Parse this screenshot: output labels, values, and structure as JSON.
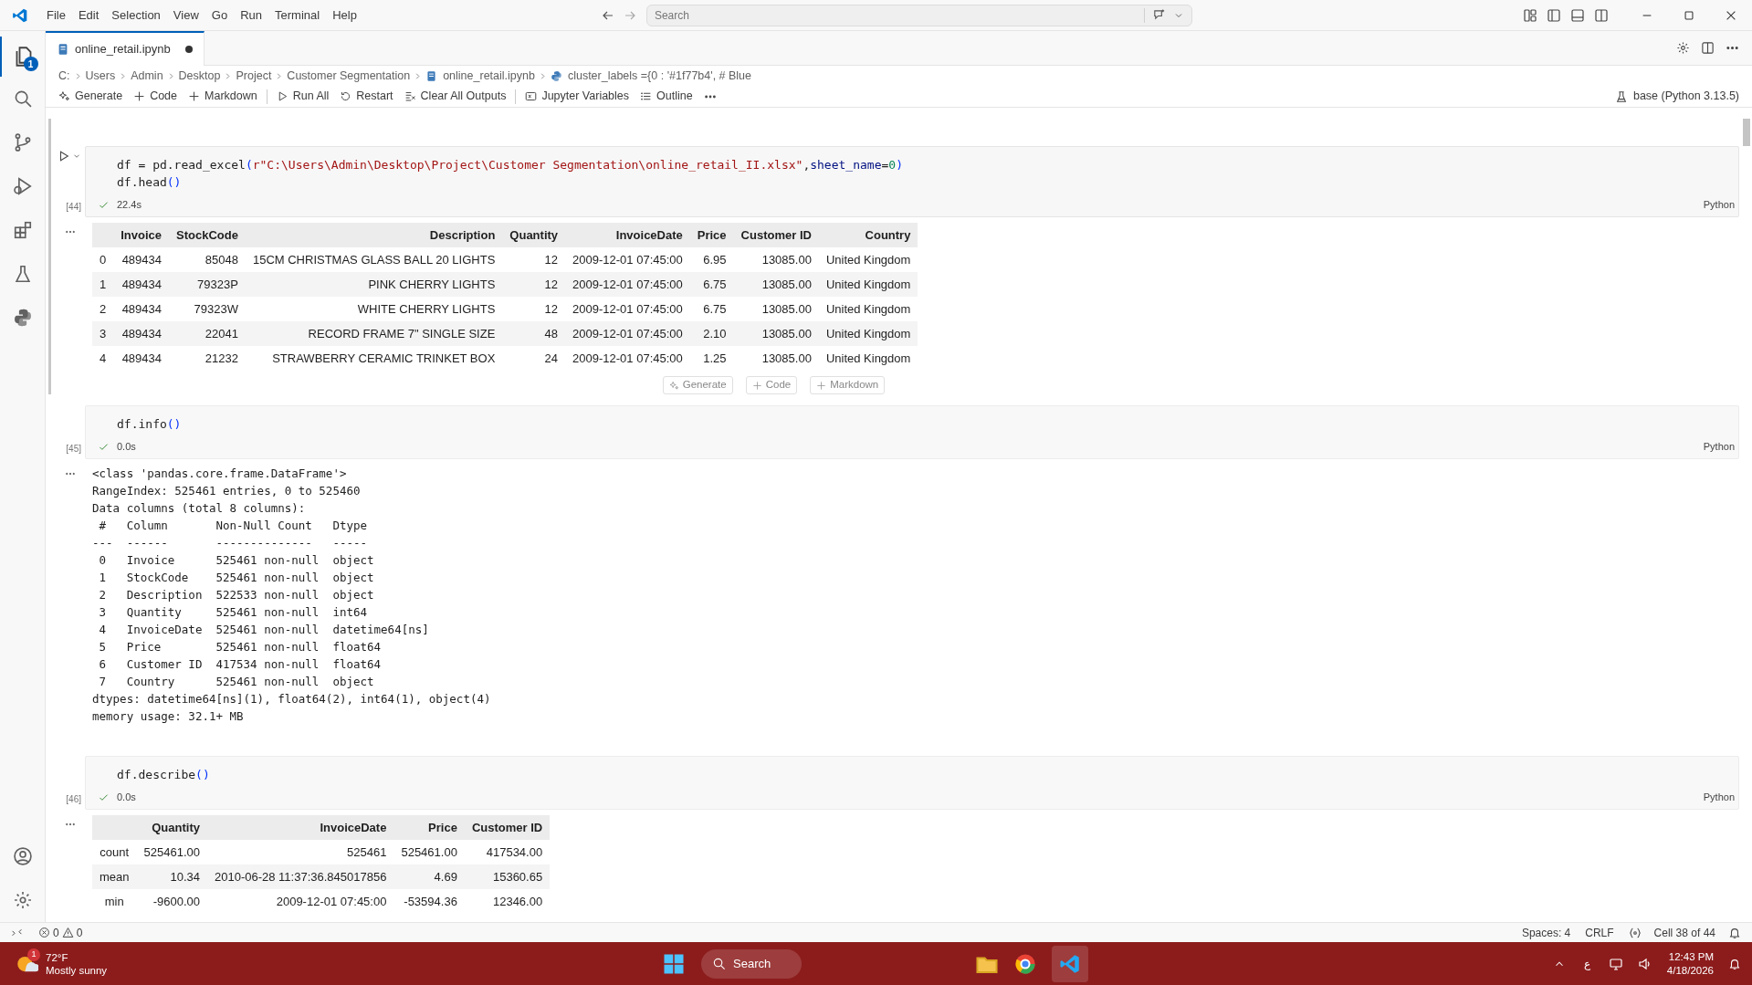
{
  "menu": [
    "File",
    "Edit",
    "Selection",
    "View",
    "Go",
    "Run",
    "Terminal",
    "Help"
  ],
  "search": {
    "placeholder": "Search"
  },
  "activity_bar": {
    "badge": "1"
  },
  "tab": {
    "label": "online_retail.ipynb",
    "modified": true
  },
  "breadcrumbs": [
    {
      "kind": "folder",
      "label": "C:"
    },
    {
      "kind": "folder",
      "label": "Users"
    },
    {
      "kind": "folder",
      "label": "Admin"
    },
    {
      "kind": "folder",
      "label": "Desktop"
    },
    {
      "kind": "folder",
      "label": "Project"
    },
    {
      "kind": "folder",
      "label": "Customer Segmentation"
    },
    {
      "kind": "notebook",
      "label": "online_retail.ipynb"
    },
    {
      "kind": "symbol",
      "label": "cluster_labels ={0 : '#1f77b4', # Blue"
    }
  ],
  "toolbar": [
    {
      "kind": "generate",
      "label": "Generate"
    },
    {
      "kind": "add",
      "label": "Code"
    },
    {
      "kind": "add",
      "label": "Markdown"
    },
    {
      "kind": "run",
      "label": "Run All"
    },
    {
      "kind": "restart",
      "label": "Restart"
    },
    {
      "kind": "clear",
      "label": "Clear All Outputs"
    },
    {
      "kind": "variables",
      "label": "Jupyter Variables"
    },
    {
      "kind": "outline",
      "label": "Outline"
    }
  ],
  "kernel": "base (Python 3.13.5)",
  "cells": [
    {
      "execution_count": "[44]",
      "focused": true,
      "time": "22.4s",
      "language": "Python",
      "code": [
        [
          {
            "kind": "plain",
            "t": "df = pd.read_excel"
          },
          {
            "kind": "paren",
            "t": "("
          },
          {
            "kind": "string",
            "t": "r\"C:\\Users\\Admin\\Desktop\\Project\\Customer Segmentation\\online_retail_II.xlsx\""
          },
          {
            "kind": "plain",
            "t": ","
          },
          {
            "kind": "param",
            "t": "sheet_name"
          },
          {
            "kind": "plain",
            "t": "="
          },
          {
            "kind": "number",
            "t": "0"
          },
          {
            "kind": "paren",
            "t": ")"
          }
        ],
        [
          {
            "kind": "plain",
            "t": "df.head"
          },
          {
            "kind": "paren",
            "t": "()"
          }
        ]
      ],
      "output": {
        "kind": "table",
        "columns": [
          "Invoice",
          "StockCode",
          "Description",
          "Quantity",
          "InvoiceDate",
          "Price",
          "Customer ID",
          "Country"
        ],
        "rows": [
          {
            "index": "0",
            "cells": [
              "489434",
              "85048",
              "15CM CHRISTMAS GLASS BALL 20 LIGHTS",
              "12",
              "2009-12-01 07:45:00",
              "6.95",
              "13085.00",
              "United Kingdom"
            ]
          },
          {
            "index": "1",
            "cells": [
              "489434",
              "79323P",
              "PINK CHERRY LIGHTS",
              "12",
              "2009-12-01 07:45:00",
              "6.75",
              "13085.00",
              "United Kingdom"
            ]
          },
          {
            "index": "2",
            "cells": [
              "489434",
              "79323W",
              "WHITE CHERRY LIGHTS",
              "12",
              "2009-12-01 07:45:00",
              "6.75",
              "13085.00",
              "United Kingdom"
            ]
          },
          {
            "index": "3",
            "cells": [
              "489434",
              "22041",
              "RECORD FRAME 7\" SINGLE SIZE",
              "48",
              "2009-12-01 07:45:00",
              "2.10",
              "13085.00",
              "United Kingdom"
            ]
          },
          {
            "index": "4",
            "cells": [
              "489434",
              "21232",
              "STRAWBERRY CERAMIC TRINKET BOX",
              "24",
              "2009-12-01 07:45:00",
              "1.25",
              "13085.00",
              "United Kingdom"
            ]
          }
        ]
      },
      "insert_toolbar": [
        "Generate",
        "Code",
        "Markdown"
      ]
    },
    {
      "execution_count": "[45]",
      "focused": false,
      "time": "0.0s",
      "language": "Python",
      "code": [
        [
          {
            "kind": "plain",
            "t": "df.info"
          },
          {
            "kind": "paren",
            "t": "()"
          }
        ]
      ],
      "output": {
        "kind": "text",
        "lines": [
          "<class 'pandas.core.frame.DataFrame'>",
          "RangeIndex: 525461 entries, 0 to 525460",
          "Data columns (total 8 columns):",
          " #   Column       Non-Null Count   Dtype         ",
          "---  ------       --------------   -----         ",
          " 0   Invoice      525461 non-null  object        ",
          " 1   StockCode    525461 non-null  object        ",
          " 2   Description  522533 non-null  object        ",
          " 3   Quantity     525461 non-null  int64         ",
          " 4   InvoiceDate  525461 non-null  datetime64[ns]",
          " 5   Price        525461 non-null  float64       ",
          " 6   Customer ID  417534 non-null  float64       ",
          " 7   Country      525461 non-null  object        ",
          "dtypes: datetime64[ns](1), float64(2), int64(1), object(4)",
          "memory usage: 32.1+ MB"
        ]
      }
    },
    {
      "execution_count": "[46]",
      "focused": false,
      "time": "0.0s",
      "language": "Python",
      "code": [
        [
          {
            "kind": "plain",
            "t": "df.describe"
          },
          {
            "kind": "paren",
            "t": "()"
          }
        ]
      ],
      "output": {
        "kind": "table",
        "columns": [
          "Quantity",
          "InvoiceDate",
          "Price",
          "Customer ID"
        ],
        "rows": [
          {
            "index": "count",
            "cells": [
              "525461.00",
              "525461",
              "525461.00",
              "417534.00"
            ]
          },
          {
            "index": "mean",
            "cells": [
              "10.34",
              "2010-06-28 11:37:36.845017856",
              "4.69",
              "15360.65"
            ]
          },
          {
            "index": "min",
            "cells": [
              "-9600.00",
              "2009-12-01 07:45:00",
              "-53594.36",
              "12346.00"
            ]
          }
        ]
      }
    }
  ],
  "status_bar": {
    "errors": "0",
    "warnings": "0",
    "items": [
      "Spaces: 4",
      "CRLF"
    ],
    "cell": "Cell 38 of 44"
  },
  "taskbar": {
    "weather_badge": "1",
    "temperature": "72°F",
    "weather": "Mostly sunny",
    "search": "Search",
    "input_language": "ع",
    "time": "12:43 PM",
    "date": "4/18/2026"
  }
}
